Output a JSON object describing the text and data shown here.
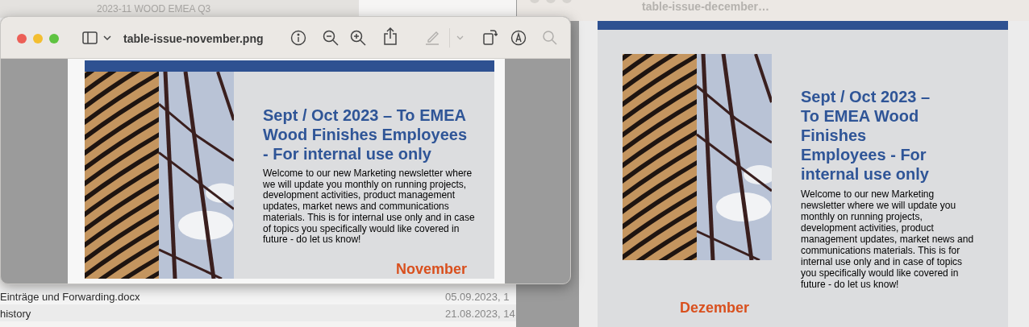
{
  "finder_window": {
    "title": "2023-11 WOOD EMEA Q3",
    "rows": [
      {
        "name": "Einträge und Forwarding.docx",
        "date": "05.09.2023, 1"
      },
      {
        "name": "history",
        "date": "21.08.2023, 14"
      }
    ]
  },
  "back_window": {
    "title": "table-issue-december…",
    "document": {
      "heading": "Sept / Oct 2023 – To EMEA Wood Finishes Employees - For internal use only",
      "body": "Welcome to our new Marketing newsletter where we will update you monthly on running projects, development activities, product management updates, market news and communications materials. This is for internal use only and in case of topics you specifically would like covered in future - do let us know!",
      "month": "Dezember"
    }
  },
  "front_window": {
    "title": "table-issue-november.png",
    "document": {
      "heading": "Sept / Oct 2023 – To EMEA Wood Finishes Employees - For internal use only",
      "body": "Welcome to our new Marketing newsletter where we will update you monthly on running projects, development activities, product management updates, market news and communications materials. This is for internal use only and in case of topics you specifically would like covered in future - do let us know!",
      "month": "November"
    }
  }
}
